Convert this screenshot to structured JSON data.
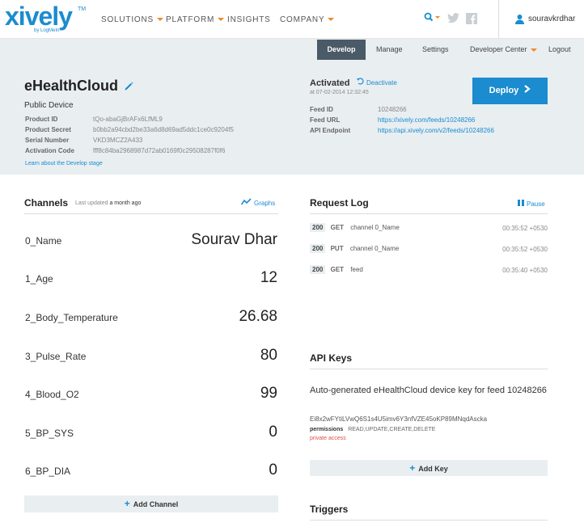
{
  "brand": {
    "logo": "xively",
    "tm": "TM",
    "sub": "by LogMeIn"
  },
  "topnav": [
    {
      "label": "SOLUTIONS",
      "dropdown": true
    },
    {
      "label": "PLATFORM",
      "dropdown": true
    },
    {
      "label": "INSIGHTS",
      "dropdown": false
    },
    {
      "label": "COMPANY",
      "dropdown": true
    }
  ],
  "user": {
    "name": "souravkrdhar"
  },
  "subnav": {
    "develop": "Develop",
    "manage": "Manage",
    "settings": "Settings",
    "developer_center": "Developer Center",
    "logout": "Logout"
  },
  "device": {
    "title": "eHealthCloud",
    "type": "Public Device",
    "fields": [
      {
        "label": "Product ID",
        "value": "tQo-abaGjBrAFx6LfML9"
      },
      {
        "label": "Product Secret",
        "value": "b0bb2a94cbd2be33a6d8d69ad5ddc1ce0c9204f5"
      },
      {
        "label": "Serial Number",
        "value": "VKD3MCZ2A433"
      },
      {
        "label": "Activation Code",
        "value": "fff8c84ba2968987d72ab0169f0c29508287f0f6"
      }
    ],
    "learn_link": "Learn about the Develop stage"
  },
  "activation": {
    "status": "Activated",
    "deactivate": "Deactivate",
    "date": "at 07-02-2014 12:32:45",
    "feed_fields": [
      {
        "label": "Feed ID",
        "value": "10248266"
      },
      {
        "label": "Feed URL",
        "value": "https://xively.com/feeds/10248266"
      },
      {
        "label": "API Endpoint",
        "value": "https://api.xively.com/v2/feeds/10248266"
      }
    ]
  },
  "deploy": {
    "label": "Deploy"
  },
  "channels": {
    "title": "Channels",
    "updated_prefix": "Last updated",
    "updated_value": "a month ago",
    "graphs": "Graphs",
    "items": [
      {
        "name": "0_Name",
        "value": "Sourav Dhar"
      },
      {
        "name": "1_Age",
        "value": "12"
      },
      {
        "name": "2_Body_Temperature",
        "value": "26.68"
      },
      {
        "name": "3_Pulse_Rate",
        "value": "80"
      },
      {
        "name": "4_Blood_O2",
        "value": "99"
      },
      {
        "name": "5_BP_SYS",
        "value": "0"
      },
      {
        "name": "6_BP_DIA",
        "value": "0"
      }
    ],
    "add_label": "Add Channel"
  },
  "request_log": {
    "title": "Request Log",
    "pause": "Pause",
    "rows": [
      {
        "code": "200",
        "method": "GET",
        "resource": "channel 0_Name",
        "time": "00:35:52 +0530"
      },
      {
        "code": "200",
        "method": "PUT",
        "resource": "channel 0_Name",
        "time": "00:35:52 +0530"
      },
      {
        "code": "200",
        "method": "GET",
        "resource": "feed",
        "time": "00:35:40 +0530"
      }
    ]
  },
  "api_keys": {
    "title": "API Keys",
    "description": "Auto-generated eHealthCloud device key for feed 10248266",
    "key": "Ei8x2wFYtiLVwQ6S1s4U5imv6Y3nfVZE45oKP89MNqdAscka",
    "permissions_label": "permissions",
    "permissions_value": "READ,UPDATE,CREATE,DELETE",
    "access": "private access",
    "add_label": "Add Key"
  },
  "triggers": {
    "title": "Triggers"
  },
  "colors": {
    "accent": "#1a8ccf",
    "orange": "#f08a24",
    "band": "#e9eef1",
    "dark_tab": "#4a5a66",
    "red": "#d9534f"
  }
}
